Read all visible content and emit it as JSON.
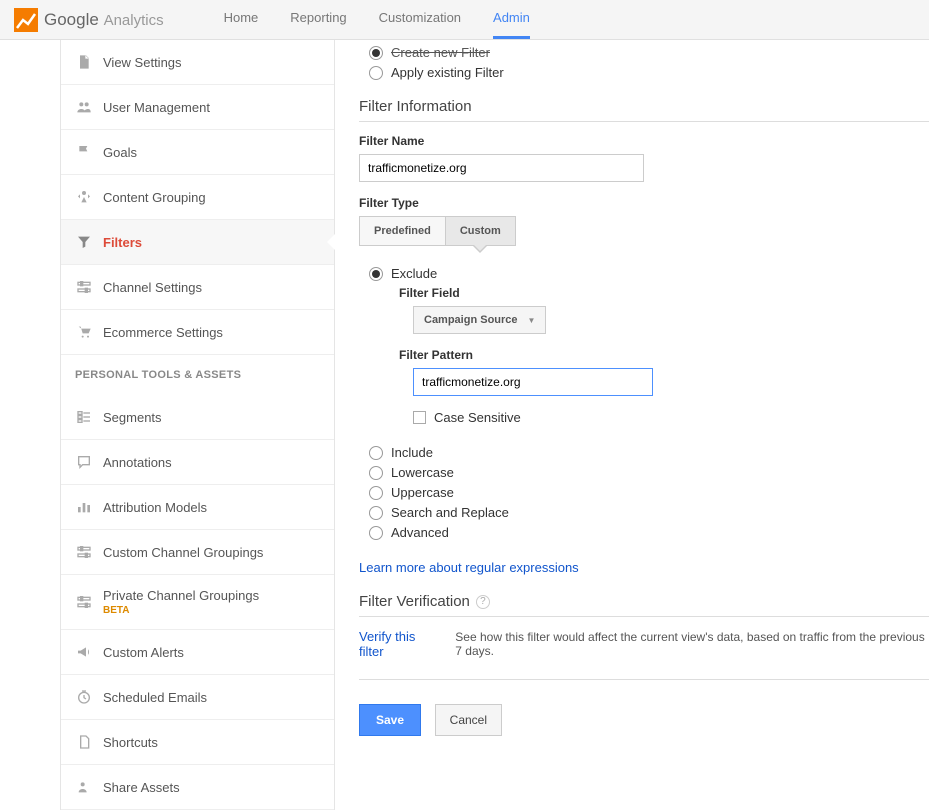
{
  "header": {
    "logo_main": "Google",
    "logo_sub": "Analytics",
    "tabs": {
      "home": "Home",
      "reporting": "Reporting",
      "customization": "Customization",
      "admin": "Admin"
    }
  },
  "sidebar": {
    "items": {
      "view_settings": "View Settings",
      "user_management": "User Management",
      "goals": "Goals",
      "content_grouping": "Content Grouping",
      "filters": "Filters",
      "channel_settings": "Channel Settings",
      "ecommerce_settings": "Ecommerce Settings"
    },
    "section_header": "PERSONAL TOOLS & ASSETS",
    "personal": {
      "segments": "Segments",
      "annotations": "Annotations",
      "attribution_models": "Attribution Models",
      "custom_channel_groupings": "Custom Channel Groupings",
      "private_channel_groupings": "Private Channel Groupings",
      "beta": "BETA",
      "custom_alerts": "Custom Alerts",
      "scheduled_emails": "Scheduled Emails",
      "shortcuts": "Shortcuts",
      "share_assets": "Share Assets"
    }
  },
  "filter_top": {
    "create_new": "Create new Filter",
    "apply_existing": "Apply existing Filter"
  },
  "filter_info": {
    "section": "Filter Information",
    "name_label": "Filter Name",
    "name_value": "trafficmonetize.org",
    "type_label": "Filter Type",
    "predefined": "Predefined",
    "custom": "Custom"
  },
  "exclude": {
    "label": "Exclude",
    "filter_field_label": "Filter Field",
    "filter_field_value": "Campaign Source",
    "filter_pattern_label": "Filter Pattern",
    "filter_pattern_value": "trafficmonetize.org",
    "case_sensitive": "Case Sensitive"
  },
  "radios": {
    "include": "Include",
    "lowercase": "Lowercase",
    "uppercase": "Uppercase",
    "search_replace": "Search and Replace",
    "advanced": "Advanced"
  },
  "links": {
    "regex": "Learn more about regular expressions"
  },
  "verification": {
    "section": "Filter Verification",
    "verify_link": "Verify this filter",
    "desc": "See how this filter would affect the current view's data, based on traffic from the previous 7 days."
  },
  "buttons": {
    "save": "Save",
    "cancel": "Cancel"
  }
}
